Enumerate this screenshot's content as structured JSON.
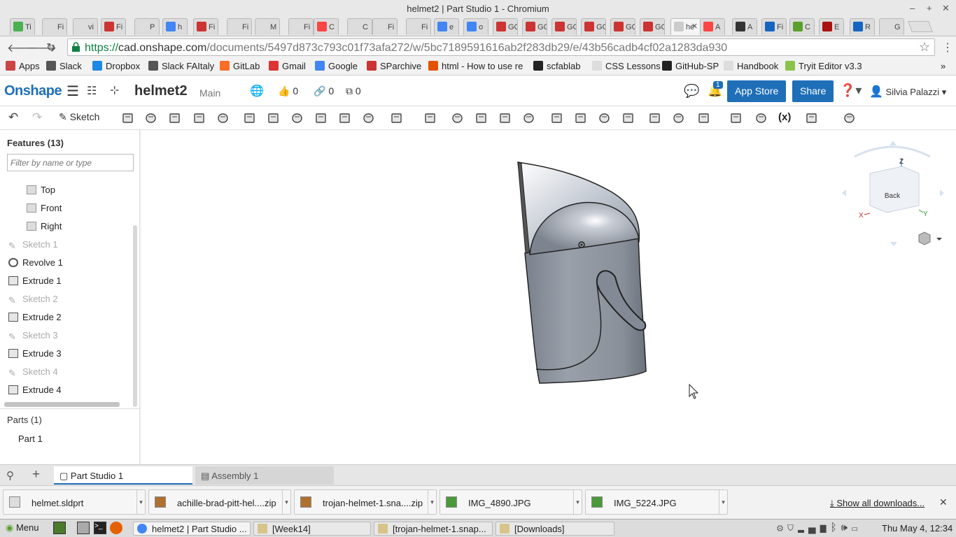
{
  "window": {
    "title": "helmet2 | Part Studio 1 - Chromium"
  },
  "tabs": [
    "Ti",
    "Fi",
    "vi",
    "Fi",
    "P",
    "h",
    "Fi",
    "Fi",
    "M",
    "Fi",
    "C",
    "C",
    "Fi",
    "Fi",
    "e",
    "o",
    "GC h",
    "GC S",
    "GC A",
    "GC T",
    "GC h",
    "GC H",
    "he",
    "A",
    "A",
    "Fi",
    "C",
    "E",
    "R",
    "G"
  ],
  "address": {
    "scheme": "https://",
    "host": "cad.onshape.com",
    "path": "/documents/5497d873c793c01f73afa272/w/5bc7189591616ab2f283db29/e/43b56cadb4cf02a1283da930"
  },
  "bookmarks": [
    "Apps",
    "Slack",
    "Dropbox",
    "Slack FAItaly",
    "GitLab",
    "Gmail",
    "Google",
    "SParchive",
    "html - How to use re",
    "scfablab",
    "CSS Lessons",
    "GitHub-SP",
    "Handbook",
    "Tryit Editor v3.3"
  ],
  "onshape": {
    "logo": "Onshape",
    "doc_name": "helmet2",
    "branch": "Main",
    "likes": "0",
    "links": "0",
    "copies": "0",
    "notifications": "1",
    "app_store": "App Store",
    "share": "Share",
    "user": "Silvia Palazzi"
  },
  "toolbar": {
    "sketch": "Sketch",
    "variable": "(x)"
  },
  "features": {
    "title": "Features (13)",
    "filter_placeholder": "Filter by name or type",
    "planes": [
      "Top",
      "Front",
      "Right"
    ],
    "items": [
      {
        "label": "Sketch 1",
        "kind": "sketch"
      },
      {
        "label": "Revolve 1",
        "kind": "revolve"
      },
      {
        "label": "Extrude 1",
        "kind": "extrude"
      },
      {
        "label": "Sketch 2",
        "kind": "sketch"
      },
      {
        "label": "Extrude 2",
        "kind": "extrude"
      },
      {
        "label": "Sketch 3",
        "kind": "sketch"
      },
      {
        "label": "Extrude 3",
        "kind": "extrude"
      },
      {
        "label": "Sketch 4",
        "kind": "sketch"
      },
      {
        "label": "Extrude 4",
        "kind": "extrude"
      }
    ],
    "parts_title": "Parts (1)",
    "parts": [
      "Part 1"
    ]
  },
  "viewcube": {
    "face": "Back",
    "axis_x": "X",
    "axis_y": "Y",
    "axis_z": "Z"
  },
  "bottom_tabs": [
    "Part Studio 1",
    "Assembly 1"
  ],
  "downloads": [
    "helmet.sldprt",
    "achille-brad-pitt-hel....zip",
    "trojan-helmet-1.sna....zip",
    "IMG_4890.JPG",
    "IMG_5224.JPG"
  ],
  "show_all_downloads": "Show all downloads...",
  "taskbar": {
    "menu": "Menu",
    "windows": [
      "helmet2 | Part Studio ...",
      "[Week14]",
      "[trojan-helmet-1.snap...",
      "[Downloads]"
    ],
    "clock": "Thu May  4, 12:34"
  }
}
